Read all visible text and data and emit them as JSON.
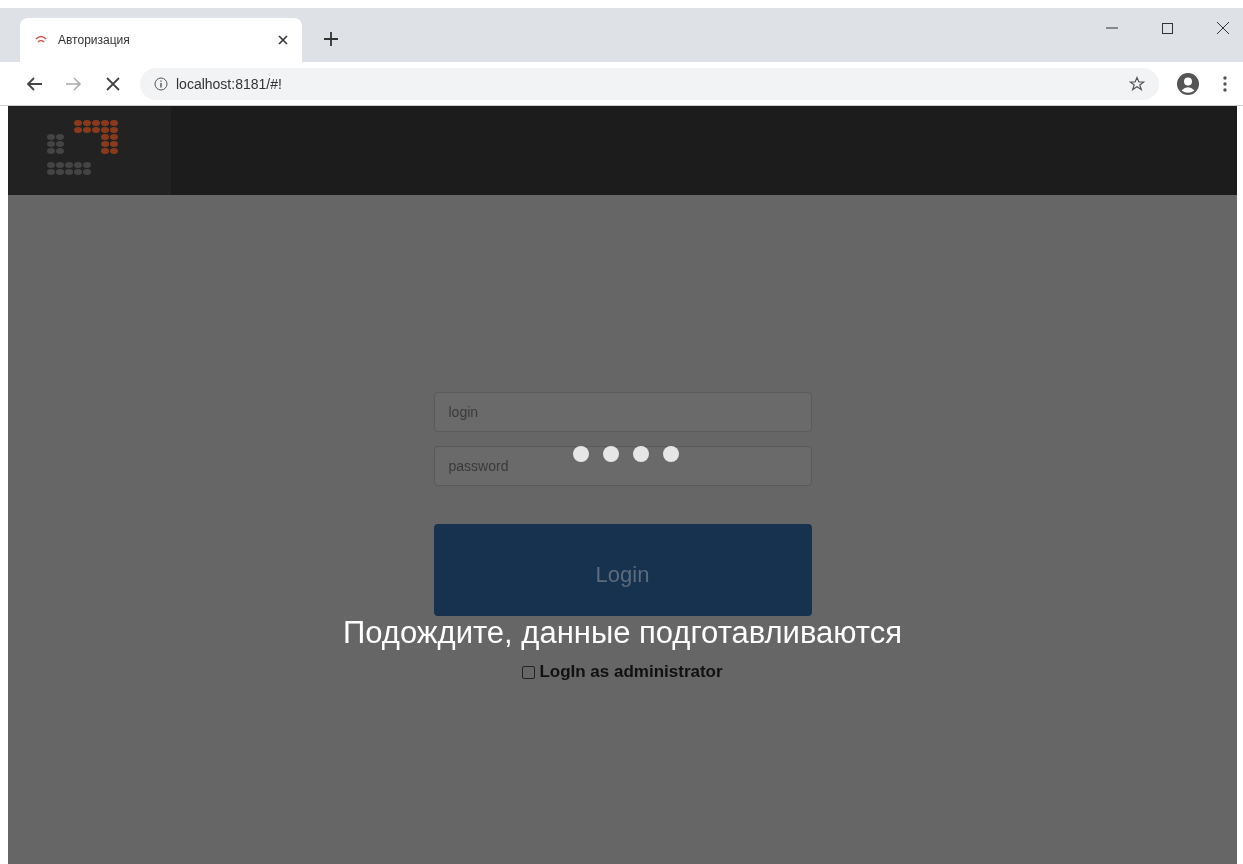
{
  "browser": {
    "tab": {
      "title": "Авторизация",
      "selected": true
    },
    "address": "localhost:8181/#!"
  },
  "login_form": {
    "login": {
      "placeholder": "login"
    },
    "password": {
      "placeholder": "password"
    },
    "button": "Login",
    "admin_checkbox": {
      "label": "LogIn as administrator",
      "checked": false
    }
  },
  "loading_overlay": {
    "message": "Подождите, данные подготавливаются"
  }
}
